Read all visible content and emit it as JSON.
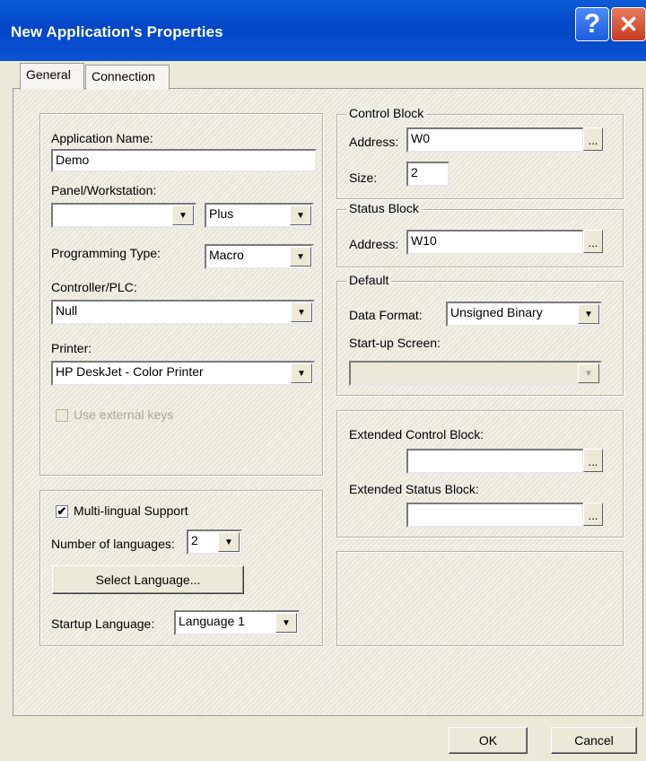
{
  "window": {
    "title": "New Application's Properties",
    "help_glyph": "?",
    "close_glyph": "✕"
  },
  "tabs": [
    {
      "label": "General",
      "active": true
    },
    {
      "label": "Connection",
      "active": false
    }
  ],
  "general": {
    "app_name_label": "Application Name:",
    "app_name_value": "Demo",
    "panel_label": "Panel/Workstation:",
    "panel_value": "",
    "panel_model_value": "Plus",
    "programming_type_label": "Programming Type:",
    "programming_type_value": "Macro",
    "controller_label": "Controller/PLC:",
    "controller_value": "Null",
    "printer_label": "Printer:",
    "printer_value": "HP DeskJet - Color Printer",
    "external_keys_label": "Use external keys"
  },
  "multilingual": {
    "support_label": "Multi-lingual Support",
    "support_checked": true,
    "num_languages_label": "Number of languages:",
    "num_languages_value": "2",
    "select_language_button": "Select Language...",
    "startup_language_label": "Startup Language:",
    "startup_language_value": "Language 1"
  },
  "control_block": {
    "title": "Control Block",
    "address_label": "Address:",
    "address_value": "W0",
    "size_label": "Size:",
    "size_value": "2",
    "browse": "..."
  },
  "status_block": {
    "title": "Status Block",
    "address_label": "Address:",
    "address_value": "W10",
    "browse": "..."
  },
  "default": {
    "title": "Default",
    "data_format_label": "Data Format:",
    "data_format_value": "Unsigned Binary",
    "startup_screen_label": "Start-up Screen:",
    "startup_screen_value": ""
  },
  "extended": {
    "control_label": "Extended Control Block:",
    "control_value": "",
    "status_label": "Extended Status Block:",
    "status_value": "",
    "browse": "..."
  },
  "buttons": {
    "ok": "OK",
    "cancel": "Cancel"
  },
  "icons": {
    "dropdown_arrow": "▼",
    "check_mark": "✔"
  }
}
